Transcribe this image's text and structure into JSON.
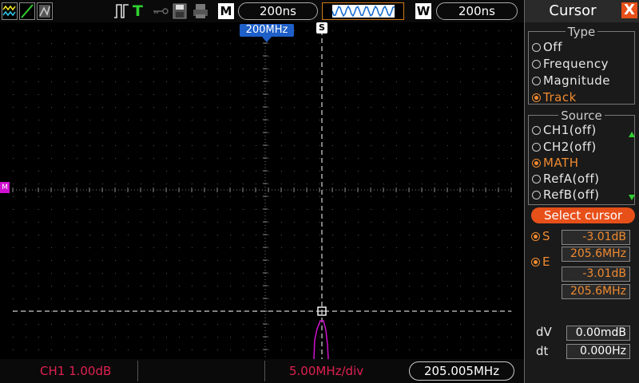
{
  "toolbar": {
    "icons": [
      "wave-display-icon",
      "vector-icon",
      "persist-icon",
      "trigger-edge-icon",
      "trigger-t-icon",
      "key-icon",
      "save-icon",
      "print-icon"
    ],
    "trigger_letter": "T",
    "m_label": "M",
    "m_value": "200ns",
    "w_label": "W",
    "w_value": "200ns"
  },
  "plot": {
    "freq_marker": "200MHz",
    "s_marker": "S",
    "math_marker": "M"
  },
  "status": {
    "ch1": "CH1 1.00dB",
    "scale": "5.00MHz/div",
    "freq": "205.005MHz"
  },
  "panel": {
    "title": "Cursor",
    "close": "X",
    "type": {
      "label": "Type",
      "options": [
        "Off",
        "Frequency",
        "Magnitude",
        "Track"
      ],
      "selected": "Track"
    },
    "source": {
      "label": "Source",
      "options": [
        "CH1(off)",
        "CH2(off)",
        "MATH",
        "RefA(off)",
        "RefB(off)"
      ],
      "selected": "MATH"
    },
    "select_cursor": "Select cursor",
    "s_label": "S",
    "s_mag": "-3.01dB",
    "s_freq": "205.6MHz",
    "e_label": "E",
    "e_mag": "-3.01dB",
    "e_freq": "205.6MHz",
    "dv_label": "dV",
    "dv_value": "0.00mdB",
    "dt_label": "dt",
    "dt_value": "0.000Hz"
  },
  "colors": {
    "accent": "#e8501a",
    "selected": "#f08a30",
    "math_trace": "#d010d0",
    "marker_blue": "#1e5fc8",
    "status_red": "#e02050"
  }
}
